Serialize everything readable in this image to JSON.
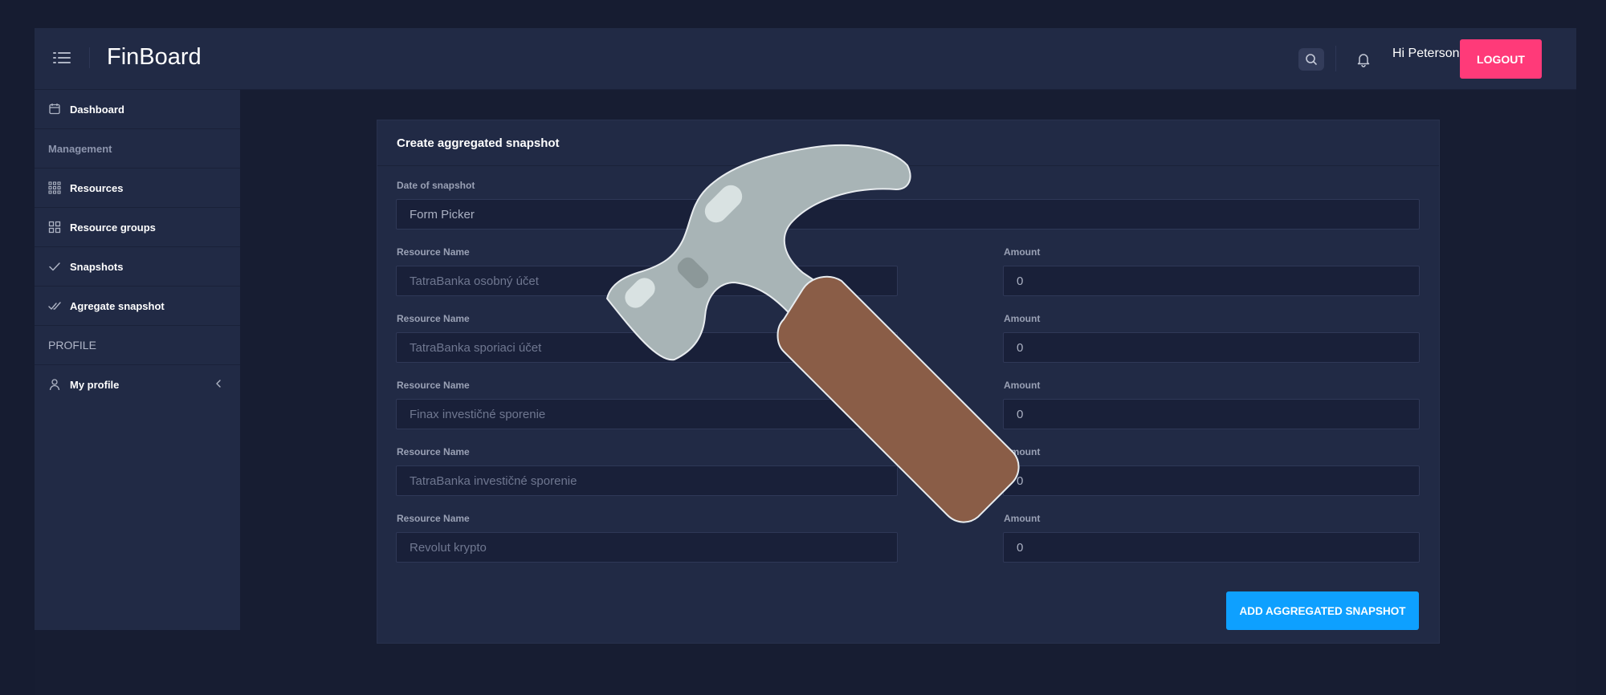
{
  "app": {
    "title": "FinBoard"
  },
  "header": {
    "greeting": "Hi Peterson!",
    "logout_label": "LOGOUT"
  },
  "sidebar": {
    "items": [
      {
        "type": "link",
        "label": "Dashboard",
        "icon": "calendar-icon"
      },
      {
        "type": "heading",
        "label": "Management"
      },
      {
        "type": "link",
        "label": "Resources",
        "icon": "grid-dots-icon"
      },
      {
        "type": "link",
        "label": "Resource groups",
        "icon": "grid-squares-icon"
      },
      {
        "type": "link",
        "label": "Snapshots",
        "icon": "check-icon"
      },
      {
        "type": "link",
        "label": "Agregate snapshot",
        "icon": "double-check-icon"
      },
      {
        "type": "heading",
        "label": "PROFILE"
      },
      {
        "type": "link",
        "label": "My profile",
        "icon": "user-icon"
      }
    ]
  },
  "form": {
    "title": "Create aggregated snapshot",
    "date_label": "Date of snapshot",
    "date_placeholder": "Form Picker",
    "rows": [
      {
        "name_label": "Resource Name",
        "name_value": "TatraBanka osobný účet",
        "amount_label": "Amount",
        "amount_value": "0"
      },
      {
        "name_label": "Resource Name",
        "name_value": "TatraBanka sporiaci účet",
        "amount_label": "Amount",
        "amount_value": "0"
      },
      {
        "name_label": "Resource Name",
        "name_value": "Finax investičné sporenie",
        "amount_label": "Amount",
        "amount_value": "0"
      },
      {
        "name_label": "Resource Name",
        "name_value": "TatraBanka investičné sporenie",
        "amount_label": "Amount",
        "amount_value": "0"
      },
      {
        "name_label": "Resource Name",
        "name_value": "Revolut krypto",
        "amount_label": "Amount",
        "amount_value": "0"
      }
    ],
    "submit_label": "ADD AGGREGATED SNAPSHOT"
  },
  "overlay": {
    "icon": "hammer-icon"
  },
  "colors": {
    "background": "#161c31",
    "panel": "#212a45",
    "logout": "#ff3a79",
    "primary": "#0ea0ff"
  }
}
